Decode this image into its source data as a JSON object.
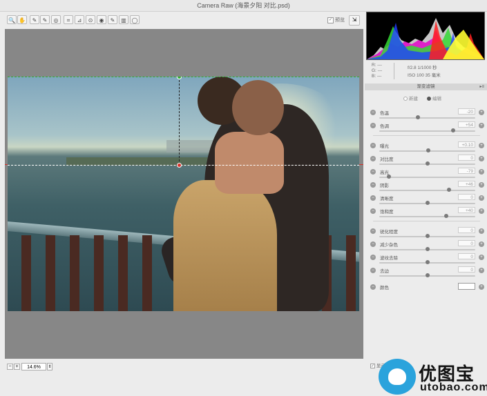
{
  "window": {
    "title": "Camera Raw (海景夕阳 对比.psd)"
  },
  "toolbar": {
    "tools": [
      {
        "name": "zoom-tool",
        "glyph": "🔍"
      },
      {
        "name": "hand-tool",
        "glyph": "✋"
      },
      {
        "name": "white-balance-tool",
        "glyph": "✎"
      },
      {
        "name": "color-sampler-tool",
        "glyph": "✎"
      },
      {
        "name": "targeted-adjust-tool",
        "glyph": "◎"
      },
      {
        "name": "crop-tool",
        "glyph": "⌗"
      },
      {
        "name": "straighten-tool",
        "glyph": "⊿"
      },
      {
        "name": "spot-removal-tool",
        "glyph": "⊙"
      },
      {
        "name": "red-eye-tool",
        "glyph": "◉"
      },
      {
        "name": "adjustment-brush-tool",
        "glyph": "✎"
      },
      {
        "name": "graduated-filter-tool",
        "glyph": "▥"
      },
      {
        "name": "radial-filter-tool",
        "glyph": "◯"
      }
    ],
    "preview_label": "预览",
    "preview_checked": "✓"
  },
  "exif": {
    "r": "R:  ---",
    "g": "G:  ---",
    "b": "B:  ---",
    "aperture_shutter": "f/2.8   1/1000 秒",
    "iso_focal": "ISO 100   35 毫米"
  },
  "panel": {
    "title": "渐变滤镜",
    "mode_new": "新建",
    "mode_edit": "编辑",
    "sliders": [
      {
        "label": "色温",
        "value": "-20",
        "pos": 0.4
      },
      {
        "label": "色调",
        "value": "+54",
        "pos": 0.77
      },
      {
        "label": "曝光",
        "value": "+0.10",
        "pos": 0.51
      },
      {
        "label": "对比度",
        "value": "0",
        "pos": 0.5
      },
      {
        "label": "高光",
        "value": "-79",
        "pos": 0.1
      },
      {
        "label": "阴影",
        "value": "+46",
        "pos": 0.73
      },
      {
        "label": "清晰度",
        "value": "0",
        "pos": 0.5
      },
      {
        "label": "饱和度",
        "value": "+40",
        "pos": 0.7
      },
      {
        "label": "锐化程度",
        "value": "0",
        "pos": 0.5
      },
      {
        "label": "减少杂色",
        "value": "0",
        "pos": 0.5
      },
      {
        "label": "波纹去除",
        "value": "0",
        "pos": 0.5
      },
      {
        "label": "去边",
        "value": "0",
        "pos": 0.5
      }
    ],
    "color_label": "颜色",
    "footer_label": "显示叠加"
  },
  "zoom": {
    "value": "14.6%"
  },
  "watermark": {
    "text": "优图宝",
    "url": "utobao.com"
  },
  "colors": {
    "green_pin": "#2eae2e",
    "red_pin": "#d8322a",
    "panel_bg": "#ececec",
    "canvas_bg": "#878787"
  }
}
